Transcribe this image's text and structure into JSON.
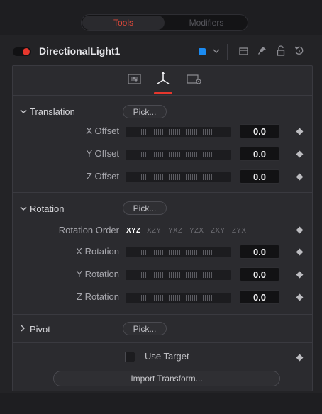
{
  "tabs": {
    "tools_label": "Tools",
    "modifiers_label": "Modifiers"
  },
  "node": {
    "name": "DirectionalLight1",
    "swatch_color": "#1b8bf2",
    "accent_color": "#e6372d"
  },
  "translation": {
    "title": "Translation",
    "pick_label": "Pick...",
    "rows": [
      {
        "label": "X Offset",
        "value": "0.0"
      },
      {
        "label": "Y Offset",
        "value": "0.0"
      },
      {
        "label": "Z Offset",
        "value": "0.0"
      }
    ]
  },
  "rotation": {
    "title": "Rotation",
    "pick_label": "Pick...",
    "order_label": "Rotation Order",
    "order_options": [
      "XYZ",
      "XZY",
      "YXZ",
      "YZX",
      "ZXY",
      "ZYX"
    ],
    "order_selected": "XYZ",
    "rows": [
      {
        "label": "X Rotation",
        "value": "0.0"
      },
      {
        "label": "Y Rotation",
        "value": "0.0"
      },
      {
        "label": "Z Rotation",
        "value": "0.0"
      }
    ]
  },
  "pivot": {
    "title": "Pivot",
    "pick_label": "Pick..."
  },
  "use_target_label": "Use Target",
  "import_transform_label": "Import Transform...",
  "icons": {
    "header": [
      "chevron-down-icon",
      "window-icon",
      "pin-icon",
      "lock-icon",
      "reset-icon"
    ],
    "tabs": [
      "controls-tab-icon",
      "transform-tab-icon",
      "settings-tab-icon"
    ]
  }
}
